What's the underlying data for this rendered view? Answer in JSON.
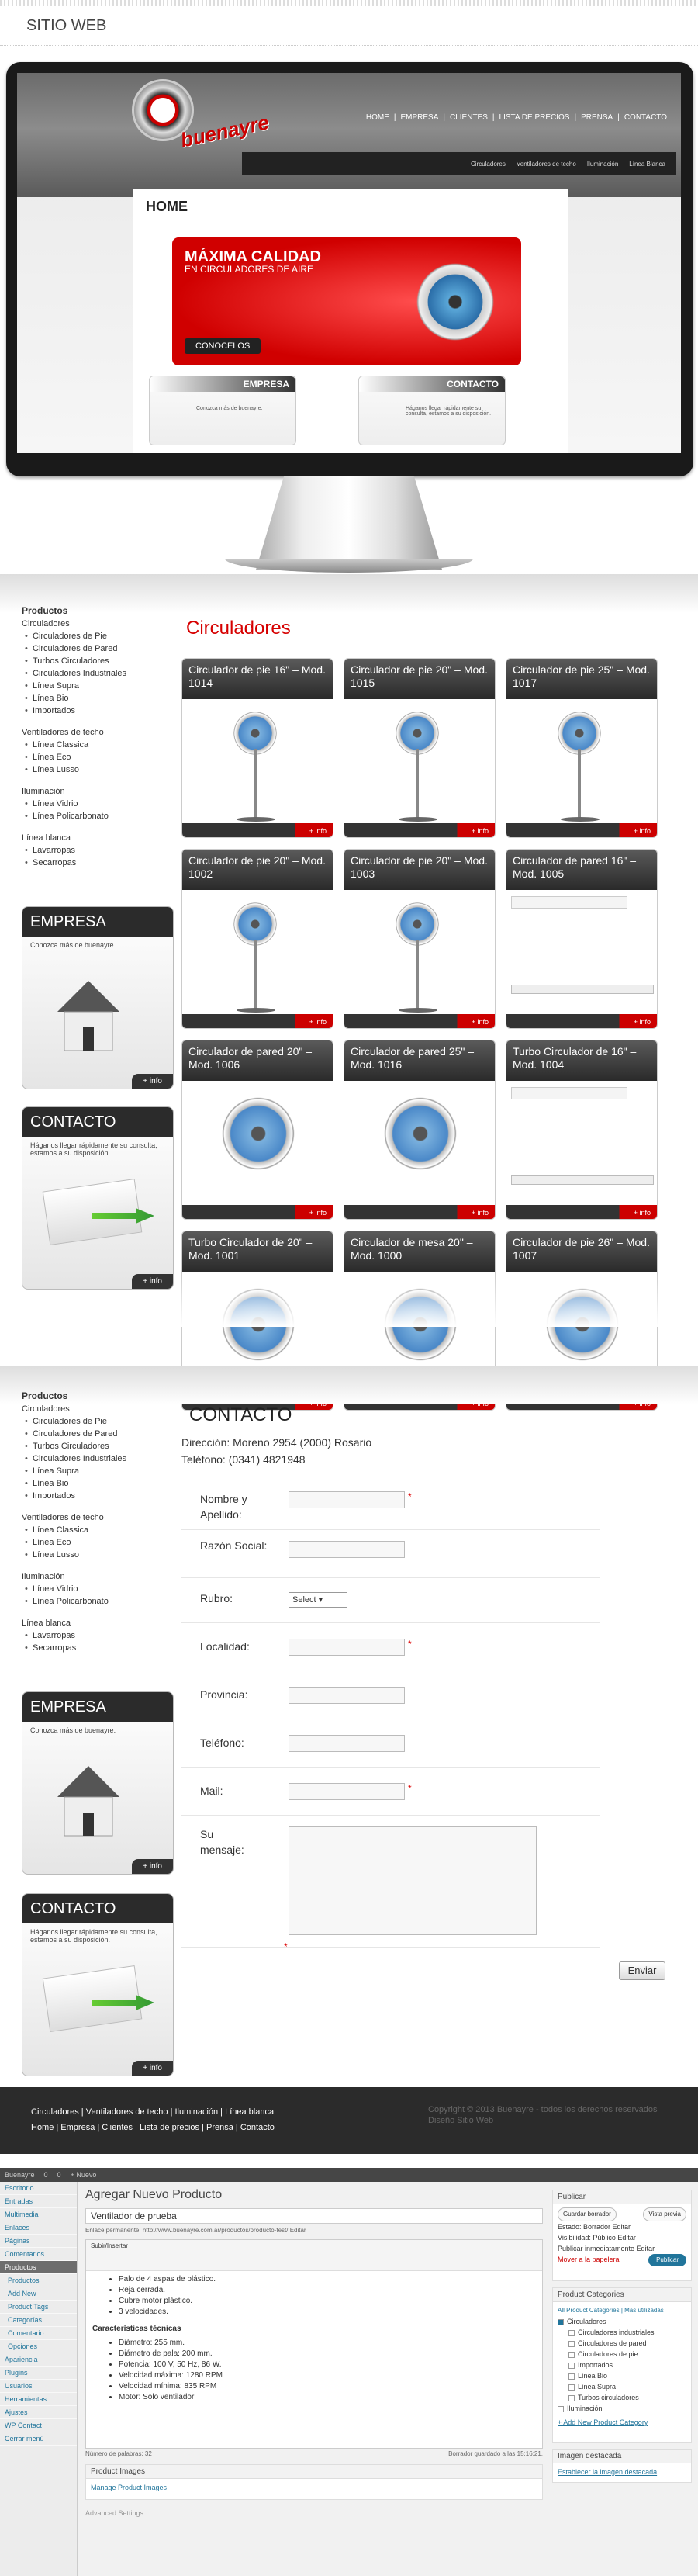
{
  "header": {
    "title": "SITIO WEB"
  },
  "mock": {
    "nav": [
      "HOME",
      "EMPRESA",
      "CLIENTES",
      "LISTA DE PRECIOS",
      "PRENSA",
      "CONTACTO"
    ],
    "subnav": [
      "Circuladores",
      "Ventiladores de techo",
      "Iluminación",
      "Línea Blanca"
    ],
    "logo": "buenayre",
    "home": "HOME",
    "banner_title": "MÁXIMA CALIDAD",
    "banner_sub": "EN CIRCULADORES DE AIRE",
    "banner_btn": "CONOCELOS",
    "empresa": "EMPRESA",
    "empresa_txt": "Conozca más de buenayre.",
    "contacto": "CONTACTO",
    "contacto_txt": "Háganos llegar rápidamente su consulta, estamos a su disposición."
  },
  "sidebar": {
    "productos": "Productos",
    "circuladores": "Circuladores",
    "circ_items": [
      "Circuladores de Pie",
      "Circuladores de Pared",
      "Turbos Circuladores",
      "Circuladores Industriales",
      "Línea Supra",
      "Línea Bio",
      "Importados"
    ],
    "techo": "Ventiladores de techo",
    "techo_items": [
      "Línea Classica",
      "Línea Eco",
      "Línea Lusso"
    ],
    "ilum": "Iluminación",
    "ilum_items": [
      "Línea Vidrio",
      "Línea Policarbonato"
    ],
    "blanca": "Línea blanca",
    "blanca_items": [
      "Lavarropas",
      "Secarropas"
    ],
    "empresa": "EMPRESA",
    "empresa_txt": "Conozca más de buenayre.",
    "contacto": "CONTACTO",
    "contacto_txt": "Háganos llegar rápidamente su consulta, estamos a su disposición.",
    "info": "+ info"
  },
  "products": {
    "title": "Circuladores",
    "more": "+ info",
    "items": [
      {
        "name": "Circulador de pie 16\" – Mod. 1014"
      },
      {
        "name": "Circulador de pie 20\" – Mod. 1015"
      },
      {
        "name": "Circulador de pie 25\" – Mod. 1017"
      },
      {
        "name": "Circulador de pie 20\" – Mod. 1002"
      },
      {
        "name": "Circulador de pie 20\" – Mod. 1003"
      },
      {
        "name": "Circulador de pared 16\" – Mod. 1005"
      },
      {
        "name": "Circulador de pared 20\" – Mod. 1006"
      },
      {
        "name": "Circulador de pared 25\" – Mod. 1016"
      },
      {
        "name": "Turbo Circulador de 16\" – Mod. 1004"
      },
      {
        "name": "Turbo Circulador de 20\" – Mod. 1001"
      },
      {
        "name": "Circulador de mesa 20\" – Mod. 1000"
      },
      {
        "name": "Circulador de pie 26\" – Mod. 1007"
      }
    ]
  },
  "contact": {
    "title": "CONTACTO",
    "address": "Dirección: Moreno 2954 (2000) Rosario",
    "phone": "Teléfono: (0341) 4821948",
    "labels": [
      "Nombre y Apellido:",
      "Razón Social:",
      "Rubro:",
      "Localidad:",
      "Provincia:",
      "Teléfono:",
      "Mail:",
      "Su mensaje:"
    ],
    "select": "Select",
    "send": "Enviar"
  },
  "footer": {
    "line1": "Circuladores | Ventiladores de techo | Iluminación | Línea blanca",
    "line2": "Home | Empresa | Clientes | Lista de precios | Prensa | Contacto",
    "copyright": "Copyright © 2013 Buenayre - todos los derechos reservados",
    "design": "Diseño Sitio Web"
  },
  "wp": {
    "bar": [
      "Buenayre",
      "0",
      "0",
      "+ Nuevo"
    ],
    "menu": [
      "Escritorio",
      "Entradas",
      "Multimedia",
      "Enlaces",
      "Páginas",
      "Comentarios",
      "Productos",
      "Productos",
      "Add New",
      "Product Tags",
      "Categorías",
      "Comentario",
      "Opciones",
      "Apariencia",
      "Plugins",
      "Usuarios",
      "Herramientas",
      "Ajustes",
      "WP Contact",
      "Cerrar menú"
    ],
    "title": "Agregar Nuevo Producto",
    "post_title": "Ventilador de prueba",
    "permalink": "Enlace permanente: http://www.buenayre.com.ar/productos/producto-test/ Editar",
    "upload": "Subir/Insertar",
    "content_list": [
      "Palo de 4 aspas de plástico.",
      "Reja cerrada.",
      "Cubre motor plástico.",
      "3 velocidades."
    ],
    "spec_title": "Características técnicas",
    "specs": [
      "Diámetro: 255 mm.",
      "Diámetro de pala: 200 mm.",
      "Potencia: 100 V, 50 Hz, 86 W.",
      "Velocidad máxima: 1280 RPM",
      "Velocidad mínima: 835 RPM",
      "Motor: Solo ventilador"
    ],
    "wordcount": "Número de palabras: 32",
    "saved": "Borrador guardado a las 15:16:21.",
    "publish_head": "Publicar",
    "save_draft": "Guardar borrador",
    "preview": "Vista previa",
    "status": "Estado: Borrador Editar",
    "visibility": "Visibilidad: Público Editar",
    "publish_now": "Publicar inmediatamente Editar",
    "trash": "Mover a la papelera",
    "publish_btn": "Publicar",
    "cat_head": "Product Categories",
    "cat_tabs": "All Product Categories | Más utilizadas",
    "cats": [
      "Circuladores",
      "Circuladores industriales",
      "Circuladores de pared",
      "Circuladores de pie",
      "Importados",
      "Línea Bio",
      "Línea Supra",
      "Turbos circuladores",
      "Iluminación"
    ],
    "add_cat": "+ Add New Product Category",
    "img_head": "Imagen destacada",
    "img_link": "Establecer la imagen destacada",
    "pimg_head": "Product Images",
    "pimg_link": "Manage Product Images",
    "adv": "Advanced Settings"
  }
}
